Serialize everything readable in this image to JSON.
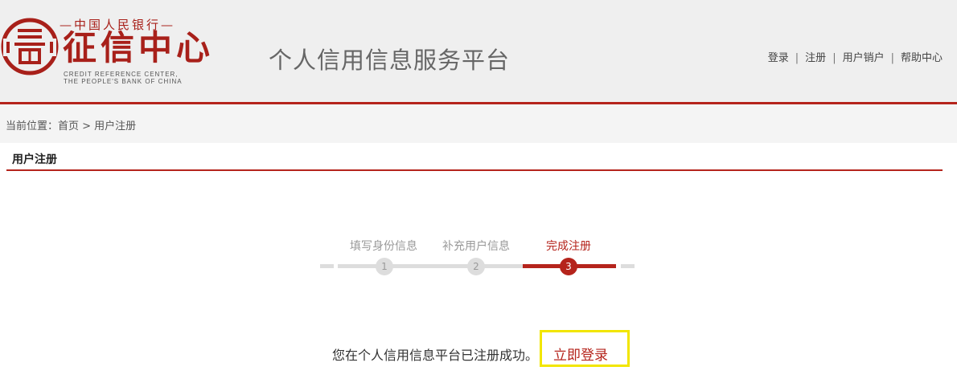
{
  "logo": {
    "top_text": "—中国人民银行—",
    "main_text": "征信中心",
    "english_line1": "CREDIT REFERENCE CENTER,",
    "english_line2": "THE PEOPLE'S BANK OF CHINA"
  },
  "header": {
    "title": "个人信用信息服务平台"
  },
  "topnav": {
    "items": [
      "登录",
      "注册",
      "用户销户",
      "帮助中心"
    ],
    "separator": "|"
  },
  "breadcrumb": {
    "text": "当前位置：首页 > 用户注册"
  },
  "section": {
    "title": "用户注册"
  },
  "steps": [
    {
      "label": "填写身份信息",
      "number": "1",
      "state": "done"
    },
    {
      "label": "补充用户信息",
      "number": "2",
      "state": "done"
    },
    {
      "label": "完成注册",
      "number": "3",
      "state": "active"
    }
  ],
  "result": {
    "message": "您在个人信用信息平台已注册成功。",
    "login_link": "立即登录"
  },
  "colors": {
    "brand_red": "#b5241c",
    "inactive_gray": "#dddddd",
    "highlight_yellow": "#f2e600"
  }
}
